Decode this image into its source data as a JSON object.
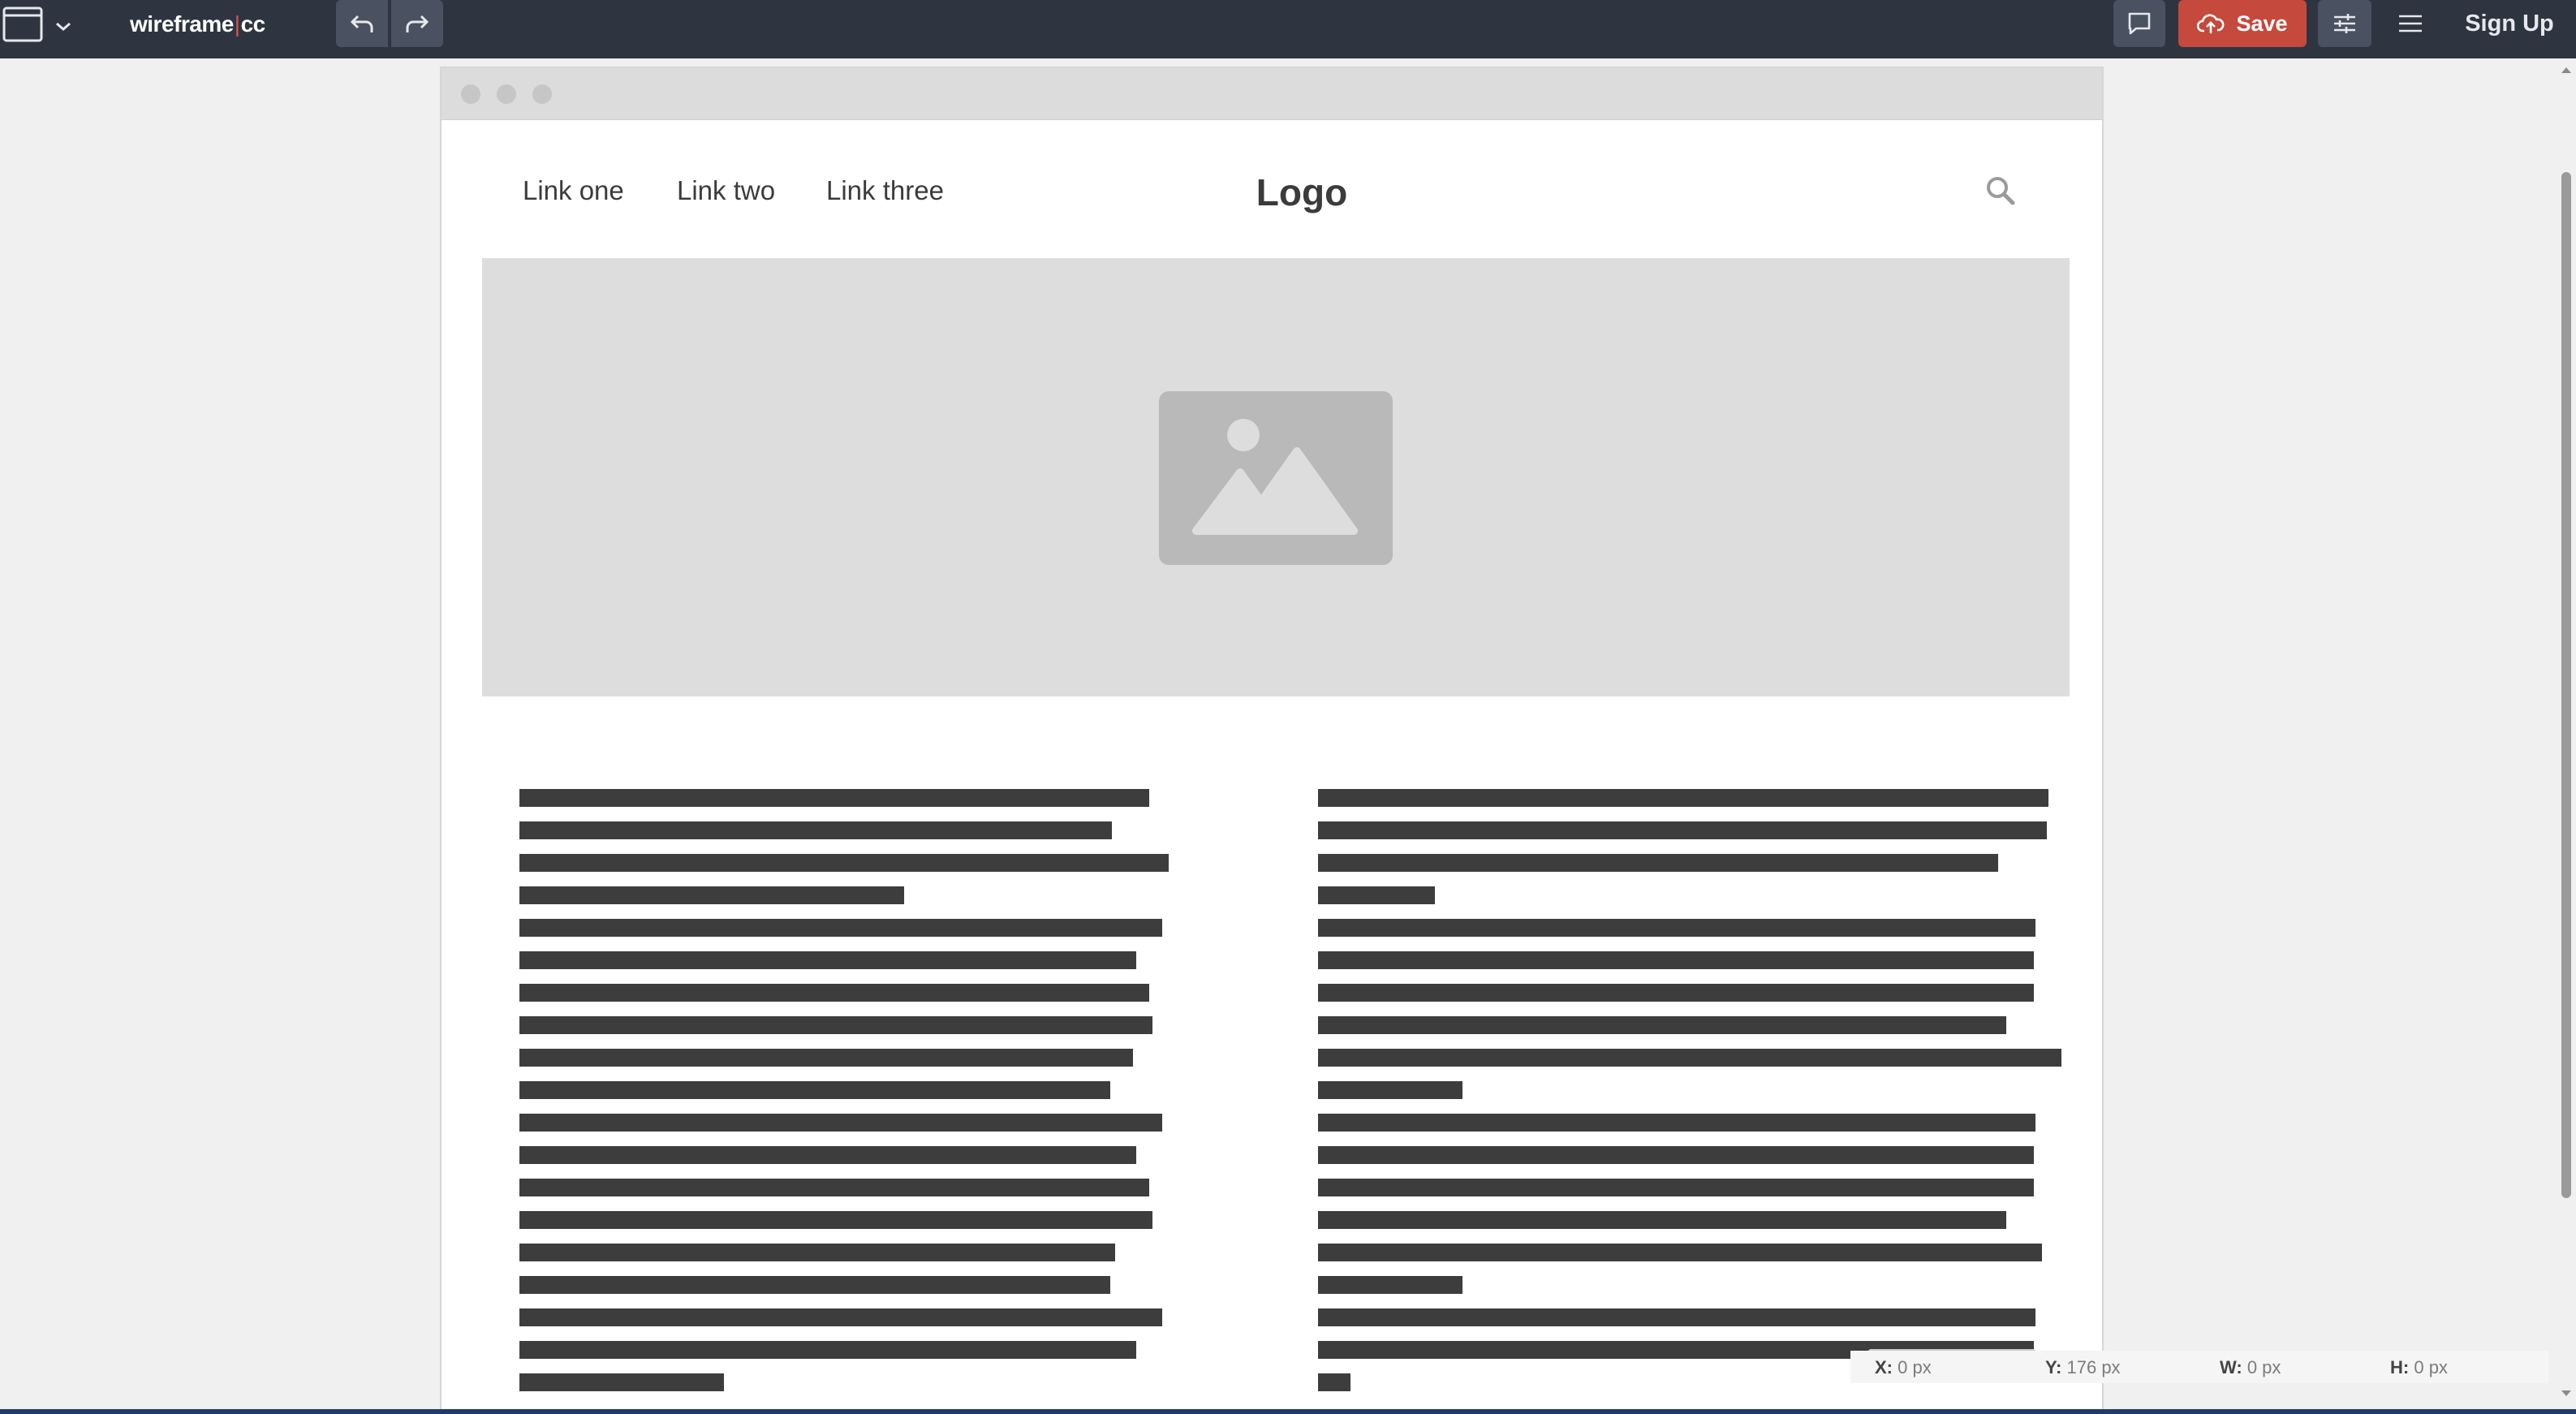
{
  "app": {
    "logo_left": "wireframe",
    "logo_sep": "|",
    "logo_right": "cc",
    "save_label": "Save",
    "signup_label": "Sign Up",
    "accent_color": "#c5493c"
  },
  "wireframe": {
    "nav_links": [
      "Link one",
      "Link two",
      "Link three"
    ],
    "logo": "Logo",
    "left_column_lines": 19,
    "right_column_lines": 19
  },
  "status": {
    "x_label": "X:",
    "x_value": "0 px",
    "y_label": "Y:",
    "y_value": "176 px",
    "w_label": "W:",
    "w_value": "0 px",
    "h_label": "H:",
    "h_value": "0 px"
  }
}
